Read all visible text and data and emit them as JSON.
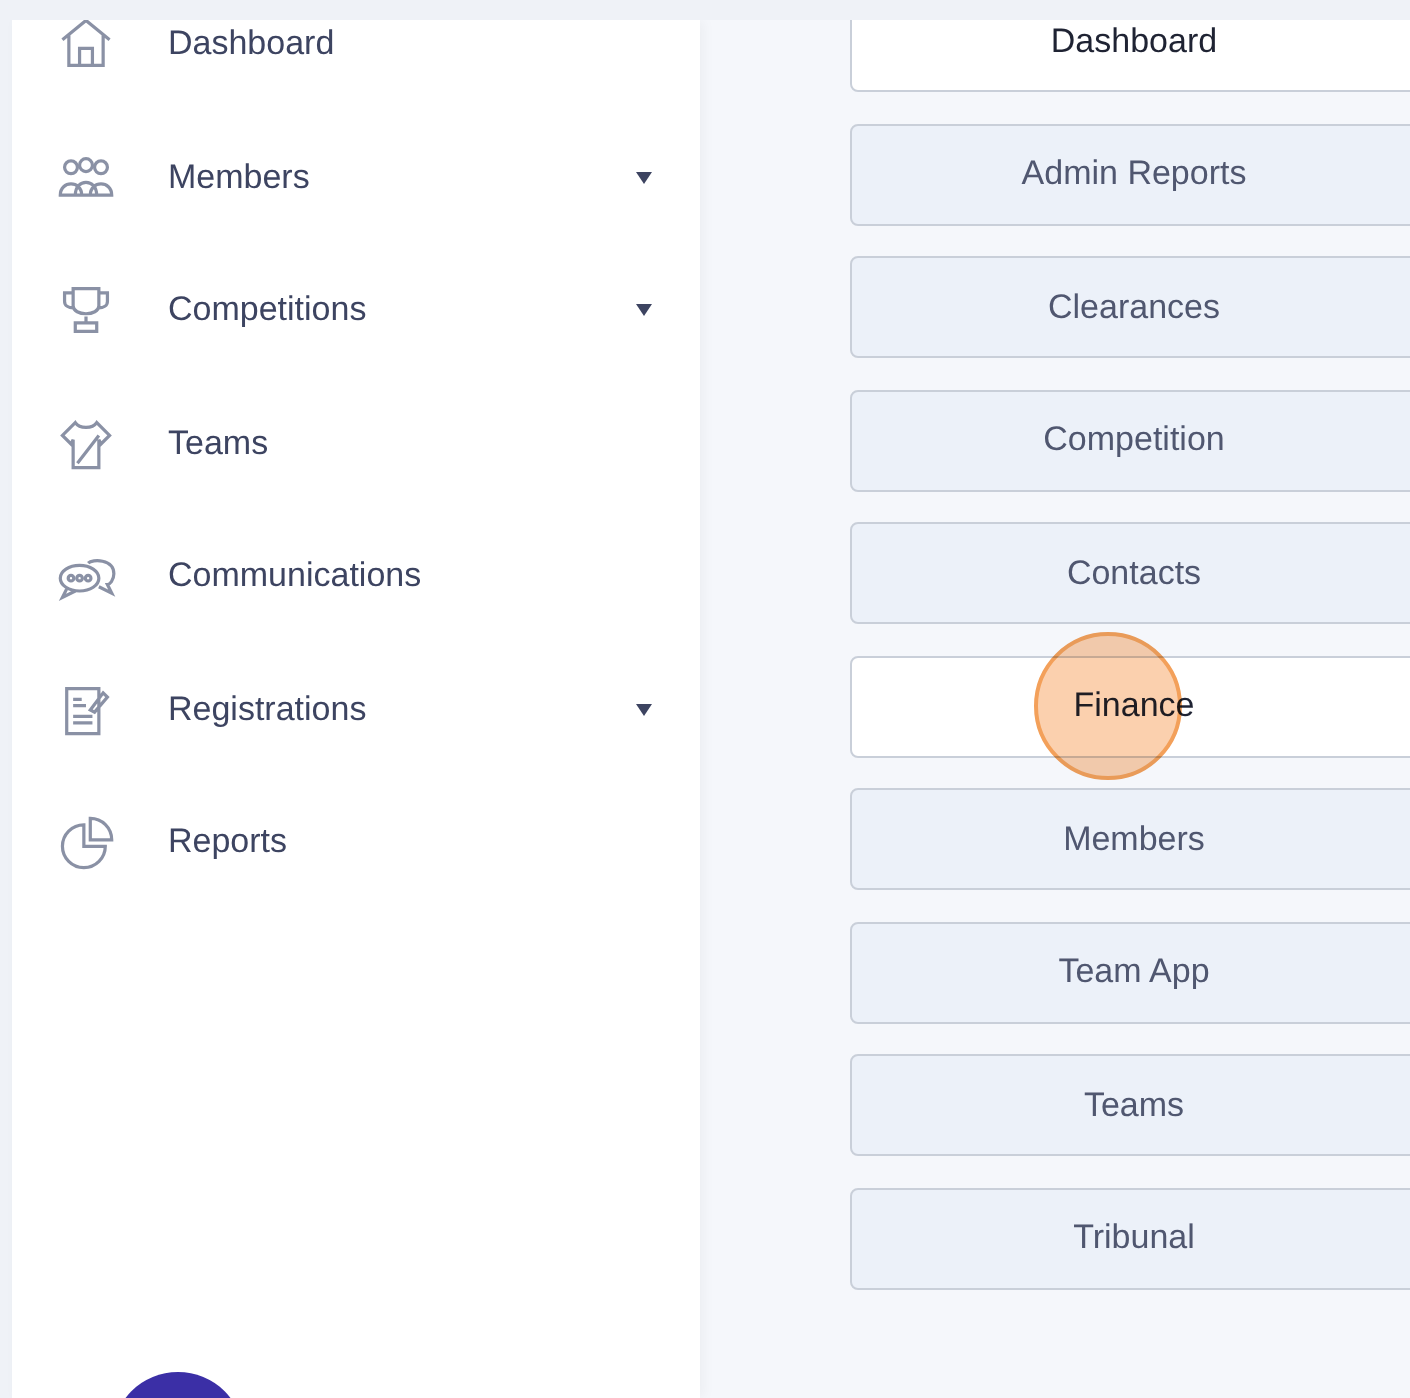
{
  "sidebar": {
    "items": [
      {
        "label": "Dashboard",
        "expandable": false
      },
      {
        "label": "Members",
        "expandable": true
      },
      {
        "label": "Competitions",
        "expandable": true
      },
      {
        "label": "Teams",
        "expandable": false
      },
      {
        "label": "Communications",
        "expandable": false
      },
      {
        "label": "Registrations",
        "expandable": true
      },
      {
        "label": "Reports",
        "expandable": false
      }
    ]
  },
  "report_menu": {
    "buttons": [
      {
        "label": "Dashboard",
        "selected": true
      },
      {
        "label": "Admin Reports",
        "selected": false
      },
      {
        "label": "Clearances",
        "selected": false
      },
      {
        "label": "Competition",
        "selected": false
      },
      {
        "label": "Contacts",
        "selected": false
      },
      {
        "label": "Finance",
        "selected": true,
        "clicked": true
      },
      {
        "label": "Members",
        "selected": false
      },
      {
        "label": "Team App",
        "selected": false
      },
      {
        "label": "Teams",
        "selected": false
      },
      {
        "label": "Tribunal",
        "selected": false
      }
    ]
  }
}
